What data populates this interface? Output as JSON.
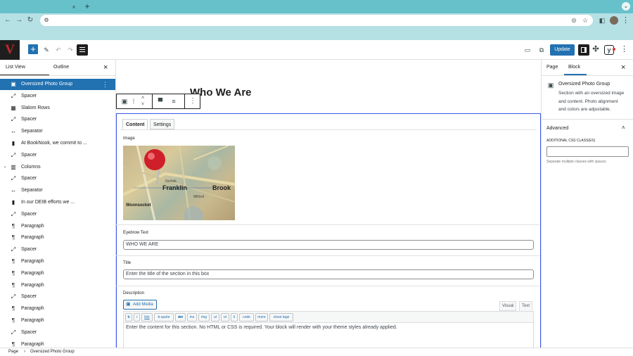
{
  "browser": {
    "new_tab_glyph": "+",
    "back_glyph": "←",
    "forward_glyph": "→",
    "reload_glyph": "↻",
    "menu_glyph": "⋮"
  },
  "toolbar": {
    "logo_text": "V",
    "add_glyph": "+",
    "update_label": "Update",
    "more_glyph": "⋮"
  },
  "left_panel": {
    "tabs": [
      "List View",
      "Outline"
    ],
    "close_glyph": "×",
    "items": [
      {
        "icon": "image-icon",
        "glyph": "▣",
        "label": "Oversized Photo Group",
        "selected": true
      },
      {
        "icon": "spacer-icon",
        "glyph": "⤢",
        "label": "Spacer"
      },
      {
        "icon": "grid-icon",
        "glyph": "▦",
        "label": "Slalom Rows"
      },
      {
        "icon": "spacer-icon",
        "glyph": "⤢",
        "label": "Spacer"
      },
      {
        "icon": "separator-icon",
        "glyph": "↔",
        "label": "Separator"
      },
      {
        "icon": "bookmark-icon",
        "glyph": "▮",
        "label": "At BookNook, we commit to ..."
      },
      {
        "icon": "spacer-icon",
        "glyph": "⤢",
        "label": "Spacer"
      },
      {
        "icon": "columns-icon",
        "glyph": "▥",
        "label": "Columns",
        "expander": true
      },
      {
        "icon": "spacer-icon",
        "glyph": "⤢",
        "label": "Spacer"
      },
      {
        "icon": "separator-icon",
        "glyph": "↔",
        "label": "Separator"
      },
      {
        "icon": "bookmark-icon",
        "glyph": "▮",
        "label": "In our DEIB efforts we ..."
      },
      {
        "icon": "spacer-icon",
        "glyph": "⤢",
        "label": "Spacer"
      },
      {
        "icon": "paragraph-icon",
        "glyph": "¶",
        "label": "Paragraph"
      },
      {
        "icon": "paragraph-icon",
        "glyph": "¶",
        "label": "Paragraph"
      },
      {
        "icon": "spacer-icon",
        "glyph": "⤢",
        "label": "Spacer"
      },
      {
        "icon": "paragraph-icon",
        "glyph": "¶",
        "label": "Paragraph"
      },
      {
        "icon": "paragraph-icon",
        "glyph": "¶",
        "label": "Paragraph"
      },
      {
        "icon": "paragraph-icon",
        "glyph": "¶",
        "label": "Paragraph"
      },
      {
        "icon": "spacer-icon",
        "glyph": "⤢",
        "label": "Spacer"
      },
      {
        "icon": "paragraph-icon",
        "glyph": "¶",
        "label": "Paragraph"
      },
      {
        "icon": "paragraph-icon",
        "glyph": "¶",
        "label": "Paragraph"
      },
      {
        "icon": "spacer-icon",
        "glyph": "⤢",
        "label": "Spacer"
      },
      {
        "icon": "paragraph-icon",
        "glyph": "¶",
        "label": "Paragraph"
      }
    ]
  },
  "canvas": {
    "page_title": "Who We Are",
    "editor_tabs": [
      "Content",
      "Settings"
    ],
    "image_label": "Image",
    "photo_labels": [
      "Franklin",
      "Brook",
      "Norfolk",
      "Woonsocket",
      "Milford"
    ],
    "eyebrow_label": "Eyebrow Text",
    "eyebrow_value": "WHO WE ARE",
    "title_label": "Title",
    "title_placeholder": "Enter the title of the section in this box",
    "description_label": "Description",
    "add_media_label": "Add Media",
    "visual_tab": "Visual",
    "text_tab": "Text",
    "quicktags": [
      "b",
      "i",
      "link",
      "b-quote",
      "del",
      "ins",
      "img",
      "ul",
      "ol",
      "li",
      "code",
      "more",
      "close tags"
    ],
    "description_text": "Enter the content for this section. No HTML or CSS is required. Your block will render with your theme styles already applied."
  },
  "right_panel": {
    "tabs": [
      "Page",
      "Block"
    ],
    "close_glyph": "×",
    "block_name": "Oversized Photo Group",
    "block_description": [
      "Section with an oversized image",
      "and content. Photo alignment",
      "and colors are adjustable."
    ],
    "advanced_label": "Advanced",
    "css_class_label": "ADDITIONAL CSS CLASS(ES)",
    "css_class_help": "Separate multiple classes with spaces."
  },
  "status_bar": {
    "crumb_page": "Page",
    "crumb_sep": "›",
    "crumb_block": "Oversized Photo Group"
  },
  "colors": {
    "accent": "#2271b1",
    "tabbar": "#67c1ca",
    "address_row": "#b5e0e4",
    "block_outline": "#3858e9"
  }
}
